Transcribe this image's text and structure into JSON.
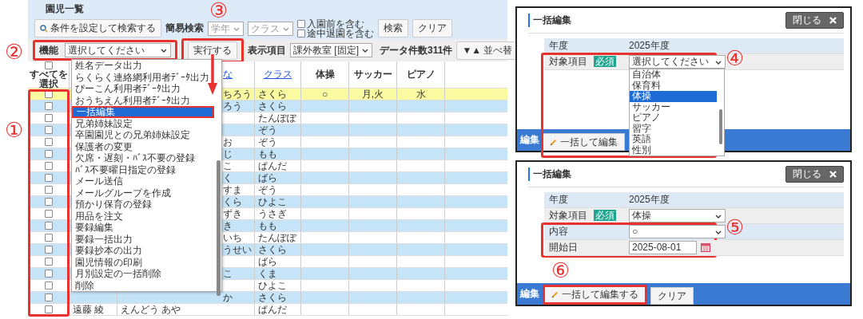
{
  "list_screen": {
    "title": "園児一覧",
    "toolbar": {
      "condition_search_button": "条件を設定して検索する",
      "quick_search_label": "簡易検索",
      "grade_select": {
        "placeholder": "学年"
      },
      "class_select": {
        "placeholder": "クラス"
      },
      "checkboxes": [
        {
          "label": "入園前を含む",
          "checked": false
        },
        {
          "label": "途中退園を含む",
          "checked": false
        }
      ],
      "search_button": "検索",
      "clear_button": "クリア"
    },
    "action_bar": {
      "function_label": "機能",
      "function_select": "選択してください",
      "execute_button": "実行する",
      "display_label": "表示項目",
      "display_select": "課外教室 [固定]",
      "record_count": "データ件数311件",
      "sort_button": "▼▲ 並べ替"
    },
    "table": {
      "select_all": {
        "label": "すべてを選択",
        "checked": false
      },
      "columns": [
        "な",
        "クラス",
        "体操",
        "サッカー",
        "ピアノ"
      ],
      "rows": [
        {
          "checked": false,
          "highlighted": true,
          "cells": [
            "ちろう",
            "さくら",
            "○",
            "月,火",
            "水"
          ]
        },
        {
          "checked": false,
          "highlighted": false,
          "cells": [
            "ろう",
            "さくら",
            "",
            "",
            ""
          ]
        },
        {
          "checked": false,
          "highlighted": false,
          "cells": [
            "",
            "たんぽぽ",
            "",
            "",
            ""
          ]
        },
        {
          "checked": false,
          "highlighted": false,
          "cells": [
            "",
            "ぞう",
            "",
            "",
            ""
          ]
        },
        {
          "checked": false,
          "highlighted": false,
          "cells": [
            "お",
            "ぞう",
            "",
            "",
            ""
          ]
        },
        {
          "checked": false,
          "highlighted": false,
          "cells": [
            "じ",
            "もも",
            "",
            "",
            ""
          ]
        },
        {
          "checked": false,
          "highlighted": false,
          "cells": [
            "こ",
            "ぱんだ",
            "",
            "",
            ""
          ]
        },
        {
          "checked": false,
          "highlighted": false,
          "cells": [
            "く",
            "ばら",
            "",
            "",
            ""
          ]
        },
        {
          "checked": false,
          "highlighted": false,
          "cells": [
            "すま",
            "ぞう",
            "",
            "",
            ""
          ]
        },
        {
          "checked": false,
          "highlighted": false,
          "cells": [
            "くら",
            "ひよこ",
            "",
            "",
            ""
          ]
        },
        {
          "checked": false,
          "highlighted": false,
          "cells": [
            "ずき",
            "うさぎ",
            "",
            "",
            ""
          ]
        },
        {
          "checked": false,
          "highlighted": false,
          "cells": [
            "き",
            "もも",
            "",
            "",
            ""
          ]
        },
        {
          "checked": false,
          "highlighted": false,
          "cells": [
            "いち",
            "たんぽぽ",
            "",
            "",
            ""
          ]
        },
        {
          "checked": false,
          "highlighted": false,
          "cells": [
            "うせい",
            "さくら",
            "",
            "",
            ""
          ]
        },
        {
          "checked": false,
          "highlighted": false,
          "cells": [
            "",
            "ばら",
            "",
            "",
            ""
          ]
        },
        {
          "checked": false,
          "highlighted": false,
          "cells": [
            "こ",
            "くま",
            "",
            "",
            ""
          ]
        },
        {
          "checked": false,
          "highlighted": false,
          "cells": [
            "",
            "ひよこ",
            "",
            "",
            ""
          ]
        },
        {
          "checked": false,
          "highlighted": false,
          "cells": [
            "か",
            "さくら",
            "",
            "",
            ""
          ]
        },
        {
          "checked": false,
          "highlighted": false,
          "name": "遠藤 綾",
          "cells": [
            "えんどう あや",
            "ぱんだ",
            "",
            "",
            ""
          ]
        }
      ]
    },
    "function_menu": {
      "items": [
        {
          "label": "姓名データ出力",
          "selected": false
        },
        {
          "label": "らくらく連絡網利用者ﾃﾞｰﾀ出力",
          "selected": false
        },
        {
          "label": "ぴーこん利用者ﾃﾞｰﾀ出力",
          "selected": false
        },
        {
          "label": "おうちえん利用者ﾃﾞｰﾀ出力",
          "selected": false
        },
        {
          "label": "一括編集",
          "selected": true
        },
        {
          "label": "兄弟姉妹設定",
          "selected": false
        },
        {
          "label": "卒園園児との兄弟姉妹設定",
          "selected": false
        },
        {
          "label": "保護者の変更",
          "selected": false
        },
        {
          "label": "欠席・遅刻・ﾊﾞｽ不要の登録",
          "selected": false
        },
        {
          "label": "ﾊﾞｽ不要曜日指定の登録",
          "selected": false
        },
        {
          "label": "メール送信",
          "selected": false
        },
        {
          "label": "メールグループを作成",
          "selected": false
        },
        {
          "label": "預かり保育の登録",
          "selected": false
        },
        {
          "label": "用品を注文",
          "selected": false
        },
        {
          "label": "要録編集",
          "selected": false
        },
        {
          "label": "要録一括出力",
          "selected": false
        },
        {
          "label": "要録抄本の出力",
          "selected": false
        },
        {
          "label": "園児情報の印刷",
          "selected": false
        },
        {
          "label": "月別設定の一括削除",
          "selected": false
        },
        {
          "label": "削除",
          "selected": false
        }
      ]
    }
  },
  "edit_dialogs": [
    {
      "title": "一括編集",
      "close_button": "閉じる",
      "fields": [
        {
          "kind": "text",
          "label": "年度",
          "value": "2025年度"
        },
        {
          "kind": "select",
          "label": "対象項目",
          "required_badge": "必須",
          "value": "選択してください"
        }
      ],
      "dropdown": {
        "items": [
          {
            "label": "自治体",
            "selected": false
          },
          {
            "label": "保育料",
            "selected": false
          },
          {
            "label": "体操",
            "selected": true
          },
          {
            "label": "サッカー",
            "selected": false
          },
          {
            "label": "ピアノ",
            "selected": false
          },
          {
            "label": "習字",
            "selected": false
          },
          {
            "label": "英語",
            "selected": false
          },
          {
            "label": "性別",
            "selected": false
          }
        ]
      },
      "footer": {
        "label": "編集",
        "buttons": [
          "一括して編集"
        ]
      }
    },
    {
      "title": "一括編集",
      "close_button": "閉じる",
      "fields": [
        {
          "kind": "text",
          "label": "年度",
          "value": "2025年度"
        },
        {
          "kind": "select",
          "label": "対象項目",
          "required_badge": "必須",
          "value": "体操"
        },
        {
          "kind": "select",
          "label": "内容",
          "value": "○"
        },
        {
          "kind": "date",
          "label": "開始日",
          "value": "2025-08-01"
        }
      ],
      "footer": {
        "label": "編集",
        "buttons": [
          "一括して編集する",
          "クリア"
        ]
      }
    }
  ],
  "annotations": [
    "①",
    "②",
    "③",
    "④",
    "⑤",
    "⑥"
  ]
}
